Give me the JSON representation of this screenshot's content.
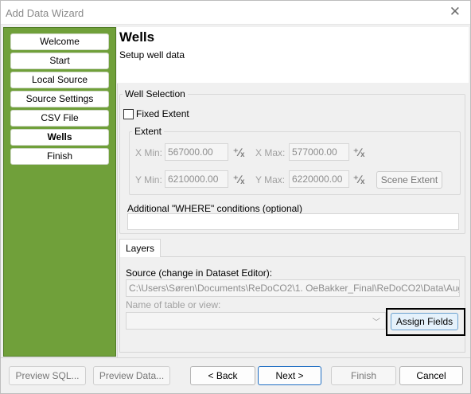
{
  "window": {
    "title": "Add Data Wizard",
    "close": "✕"
  },
  "nav": {
    "items": [
      {
        "label": "Welcome"
      },
      {
        "label": "Start"
      },
      {
        "label": "Local Source"
      },
      {
        "label": "Source Settings"
      },
      {
        "label": "CSV File"
      },
      {
        "label": "Wells"
      },
      {
        "label": "Finish"
      }
    ]
  },
  "header": {
    "title": "Wells",
    "subtitle": "Setup well data"
  },
  "well_selection": {
    "legend": "Well Selection",
    "fixed_extent_label": "Fixed Extent",
    "fixed_extent_checked": false,
    "extent": {
      "legend": "Extent",
      "xmin_label": "X Min:",
      "xmin_value": "567000.00",
      "xmax_label": "X Max:",
      "xmax_value": "577000.00",
      "ymin_label": "Y Min:",
      "ymin_value": "6210000.00",
      "ymax_label": "Y Max:",
      "ymax_value": "6220000.00",
      "scene_extent_label": "Scene Extent"
    },
    "where_label": "Additional \"WHERE\" conditions (optional)",
    "where_value": ""
  },
  "layers": {
    "tab_label": "Layers",
    "source_label": "Source (change in Dataset Editor):",
    "source_value": "C:\\Users\\Søren\\Documents\\ReDoCO2\\1. OeBakker_Final\\ReDoCO2\\Data\\Aug",
    "table_label": "Name of table or view:",
    "table_value": "",
    "assign_fields_label": "Assign Fields"
  },
  "footer": {
    "preview_sql": "Preview SQL...",
    "preview_data": "Preview Data...",
    "back": "< Back",
    "next": "Next >",
    "finish": "Finish",
    "cancel": "Cancel"
  },
  "icons": {
    "calculator": "calculator-icon"
  }
}
